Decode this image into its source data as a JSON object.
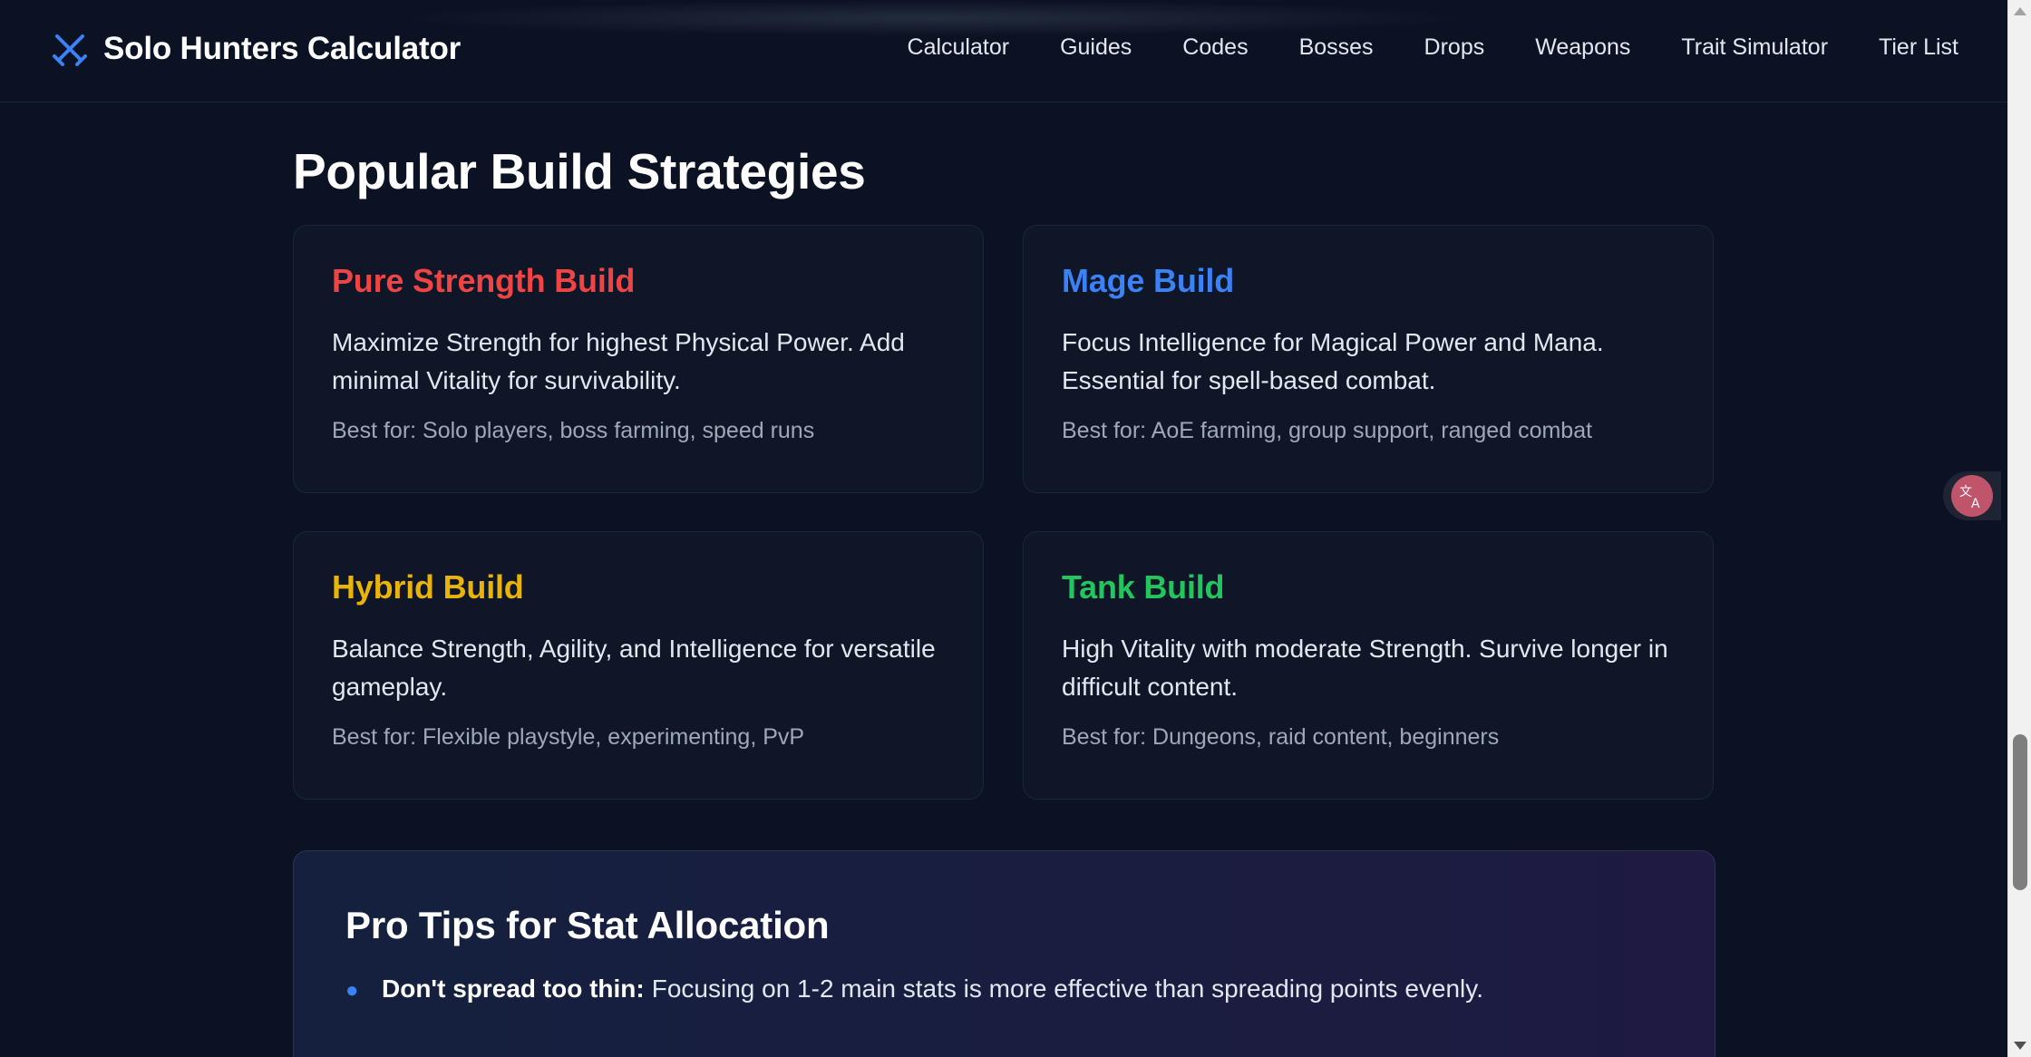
{
  "header": {
    "title": "Solo Hunters Calculator",
    "logo_icon": "crossed-swords-icon",
    "nav": [
      "Calculator",
      "Guides",
      "Codes",
      "Bosses",
      "Drops",
      "Weapons",
      "Trait Simulator",
      "Tier List"
    ]
  },
  "main": {
    "section_title": "Popular Build Strategies",
    "cards": [
      {
        "title": "Pure Strength Build",
        "color": "#ef4444",
        "description": "Maximize Strength for highest Physical Power. Add minimal Vitality for survivability.",
        "best_for": "Best for: Solo players, boss farming, speed runs"
      },
      {
        "title": "Mage Build",
        "color": "#3b82f6",
        "description": "Focus Intelligence for Magical Power and Mana. Essential for spell-based combat.",
        "best_for": "Best for: AoE farming, group support, ranged combat"
      },
      {
        "title": "Hybrid Build",
        "color": "#eab308",
        "description": "Balance Strength, Agility, and Intelligence for versatile gameplay.",
        "best_for": "Best for: Flexible playstyle, experimenting, PvP"
      },
      {
        "title": "Tank Build",
        "color": "#22c55e",
        "description": "High Vitality with moderate Strength. Survive longer in difficult content.",
        "best_for": "Best for: Dungeons, raid content, beginners"
      }
    ],
    "pro_tips": {
      "title": "Pro Tips for Stat Allocation",
      "tips": [
        {
          "strong": "Don't spread too thin:",
          "text": "Focusing on 1-2 main stats is more effective than spreading points evenly."
        }
      ]
    }
  },
  "floating": {
    "translate_icon": "translate-icon"
  },
  "colors": {
    "background": "#0b1224",
    "accent": "#3b82f6"
  }
}
